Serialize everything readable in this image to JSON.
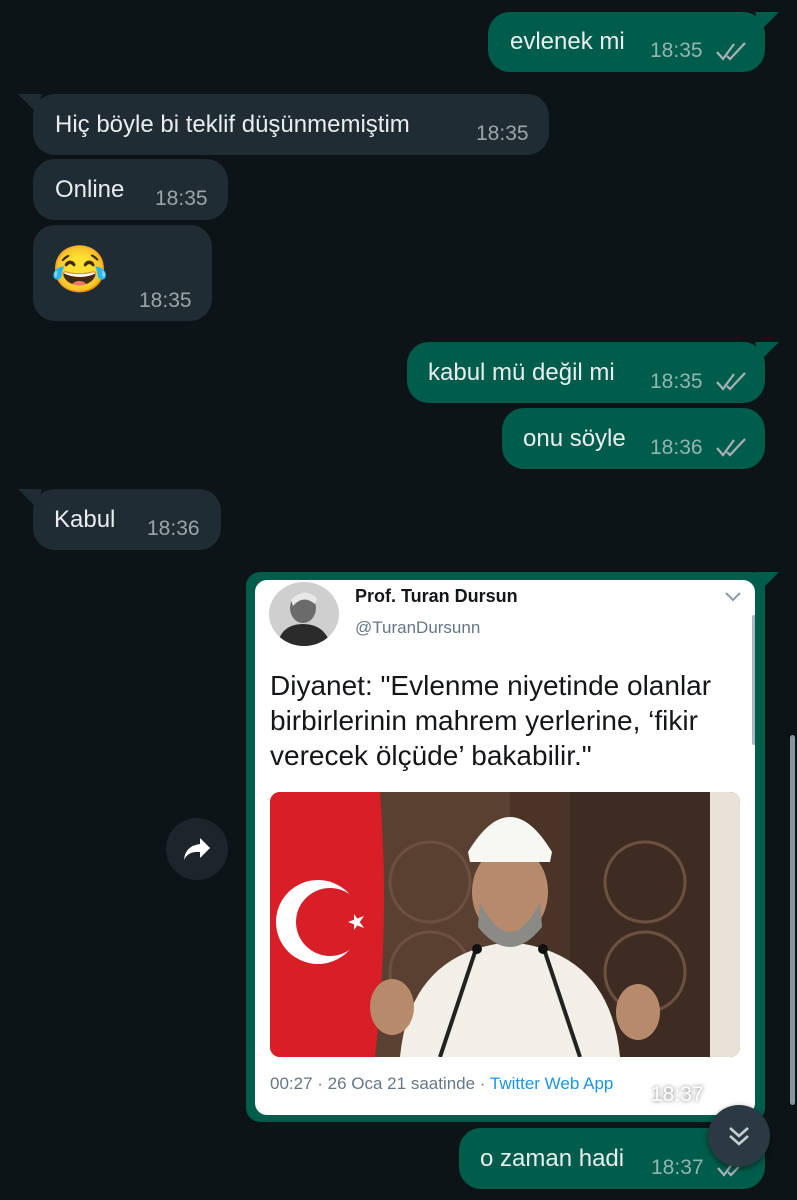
{
  "messages": [
    {
      "text": "evlenek mi",
      "time": "18:35"
    },
    {
      "text": "Hiç böyle bi teklif düşünmemiştim",
      "time": "18:35"
    },
    {
      "text": "Online",
      "time": "18:35"
    },
    {
      "emoji": "😂",
      "time": "18:35"
    },
    {
      "text": "kabul mü değil mi",
      "time": "18:35"
    },
    {
      "text": "onu söyle",
      "time": "18:36"
    },
    {
      "text": "Kabul",
      "time": "18:36"
    },
    {
      "time": "18:37"
    },
    {
      "text": "o zaman hadi",
      "time": "18:37"
    }
  ],
  "tweet": {
    "name": "Prof. Turan Dursun",
    "handle": "@TuranDursunn",
    "text": "Diyanet: \"Evlenme niyetinde olanlar birbirlerinin mahrem yerlerine, ‘fikir verecek ölçüde’ bakabilir.\"",
    "meta_time": "00:27 · 26 Oca 21 saatinde · ",
    "meta_app": "Twitter Web App"
  },
  "icons": {
    "read": "double-check-icon",
    "forward": "forward-arrow-icon",
    "scroll": "double-chevron-down-icon"
  },
  "colors": {
    "background": "#0d1418",
    "incoming_bubble": "#1f2c33",
    "outgoing_bubble": "#005c4b"
  }
}
